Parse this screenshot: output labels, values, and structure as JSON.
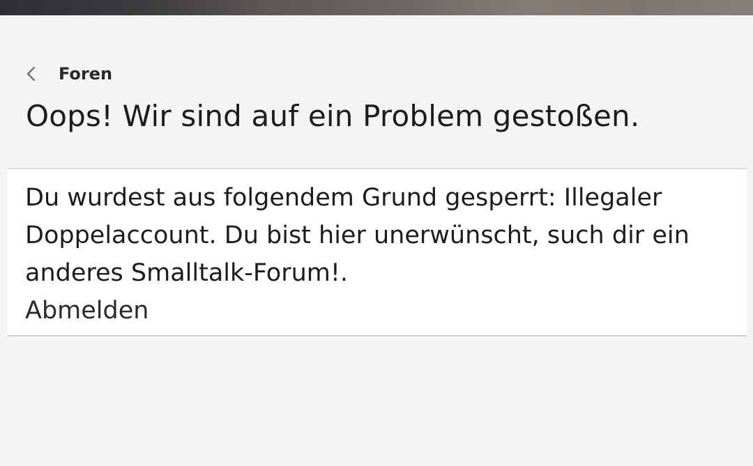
{
  "header": {
    "back_label": "Foren",
    "back_icon": "chevron-left-icon"
  },
  "page": {
    "title": "Oops! Wir sind auf ein Problem gestoßen."
  },
  "error_card": {
    "message": "Du wurdest aus folgendem Grund gesperrt: Illegaler Doppelaccount. Du bist hier unerwünscht, such dir ein anderes Smalltalk-Forum!.",
    "logout_label": "Abmelden"
  },
  "colors": {
    "background": "#f4f4f4",
    "card": "#ffffff",
    "text": "#1c1c1c",
    "divider": "#d6d6d6"
  }
}
